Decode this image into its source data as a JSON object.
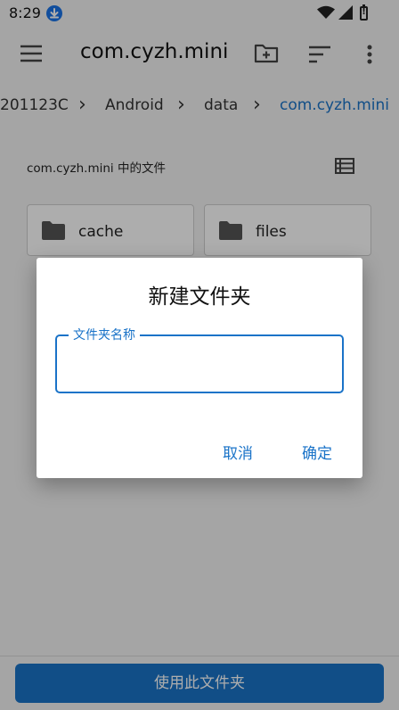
{
  "status_bar": {
    "time": "8:29",
    "battery_glyph": "!"
  },
  "toolbar": {
    "title": "com.cyzh.mini"
  },
  "breadcrumbs": {
    "items": [
      "201123C",
      "Android",
      "data",
      "com.cyzh.mini"
    ],
    "separator": "›",
    "active_color": "#1a73c8"
  },
  "content": {
    "section_label": "com.cyzh.mini 中的文件",
    "folders": [
      {
        "name": "cache"
      },
      {
        "name": "files"
      }
    ]
  },
  "bottom_bar": {
    "button_label": "使用此文件夹"
  },
  "dialog": {
    "title": "新建文件夹",
    "field_label": "文件夹名称",
    "field_value": "",
    "cancel_label": "取消",
    "ok_label": "确定"
  }
}
